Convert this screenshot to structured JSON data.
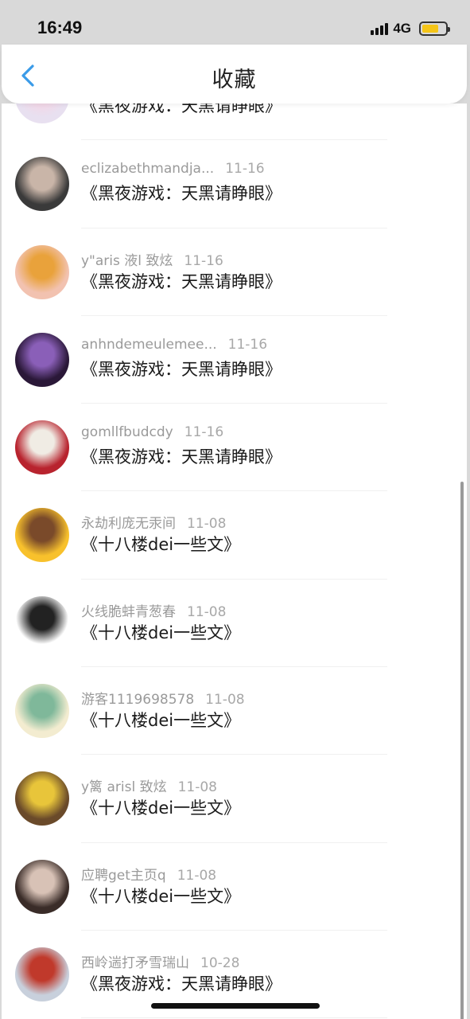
{
  "status_bar": {
    "time": "16:49",
    "network": "4G",
    "battery_level": 0.7,
    "battery_color": "#f5c518"
  },
  "header": {
    "title": "收藏",
    "back_icon": "chevron-left-icon",
    "accent_color": "#3a9be8"
  },
  "favorites": [
    {
      "user": "",
      "date": "",
      "title": "《黑夜游戏：天黑请睁眼》",
      "avatar_colors": [
        "#e8e0f0",
        "#f3d6e6"
      ]
    },
    {
      "user": "eclizabethmandja...",
      "date": "11-16",
      "title": "《黑夜游戏：天黑请睁眼》",
      "avatar_colors": [
        "#3a3a3a",
        "#c9b5a8"
      ]
    },
    {
      "user": "y\"aris 液l 致炫",
      "date": "11-16",
      "title": "《黑夜游戏：天黑请睁眼》",
      "avatar_colors": [
        "#f2c2b0",
        "#e9a23b"
      ]
    },
    {
      "user": "anhndemeulemee...",
      "date": "11-16",
      "title": "《黑夜游戏：天黑请睁眼》",
      "avatar_colors": [
        "#2a1838",
        "#8a5fb8"
      ]
    },
    {
      "user": "gomllfbudcdy",
      "date": "11-16",
      "title": "《黑夜游戏：天黑请睁眼》",
      "avatar_colors": [
        "#b8232e",
        "#f0ece4"
      ]
    },
    {
      "user": "永劫利庞无汞间",
      "date": "11-08",
      "title": "《十八楼dei一些文》",
      "avatar_colors": [
        "#f8c12c",
        "#7a4a2a"
      ]
    },
    {
      "user": "火线脆蚌青葱春",
      "date": "11-08",
      "title": "《十八楼dei一些文》",
      "avatar_colors": [
        "#ffffff",
        "#222222"
      ]
    },
    {
      "user": "游客1119698578",
      "date": "11-08",
      "title": "《十八楼dei一些文》",
      "avatar_colors": [
        "#f3ecd0",
        "#7fb89a"
      ]
    },
    {
      "user": "y篱 arisl 致炫",
      "date": "11-08",
      "title": "《十八楼dei一些文》",
      "avatar_colors": [
        "#6a4a2a",
        "#e8c53a"
      ]
    },
    {
      "user": "应聘get主页q",
      "date": "11-08",
      "title": "《十八楼dei一些文》",
      "avatar_colors": [
        "#3a2c28",
        "#d8c2b6"
      ]
    },
    {
      "user": "西岭遄打矛雪瑞山",
      "date": "10-28",
      "title": "《黑夜游戏：天黑请睁眼》",
      "avatar_colors": [
        "#c8d0dc",
        "#c0392b"
      ]
    }
  ]
}
